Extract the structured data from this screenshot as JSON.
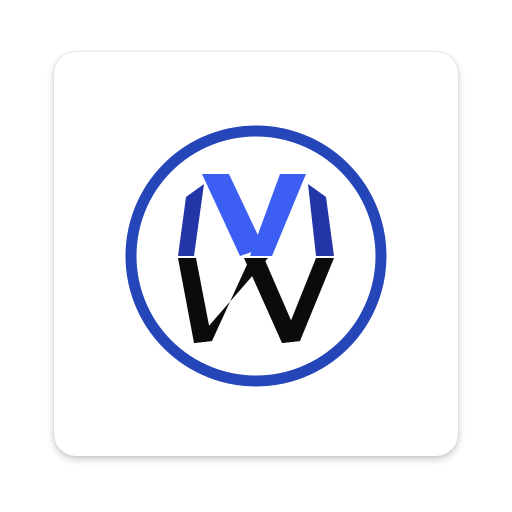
{
  "app_icon": {
    "icon": "vw-monogram-logo-icon",
    "colors": {
      "ring": "#2446B8",
      "upper_letter_main": "#3C5EF2",
      "upper_letter_shade": "#2236A8",
      "lower_letter": "#0B0B0B",
      "tile": "#FFFFFF"
    }
  }
}
